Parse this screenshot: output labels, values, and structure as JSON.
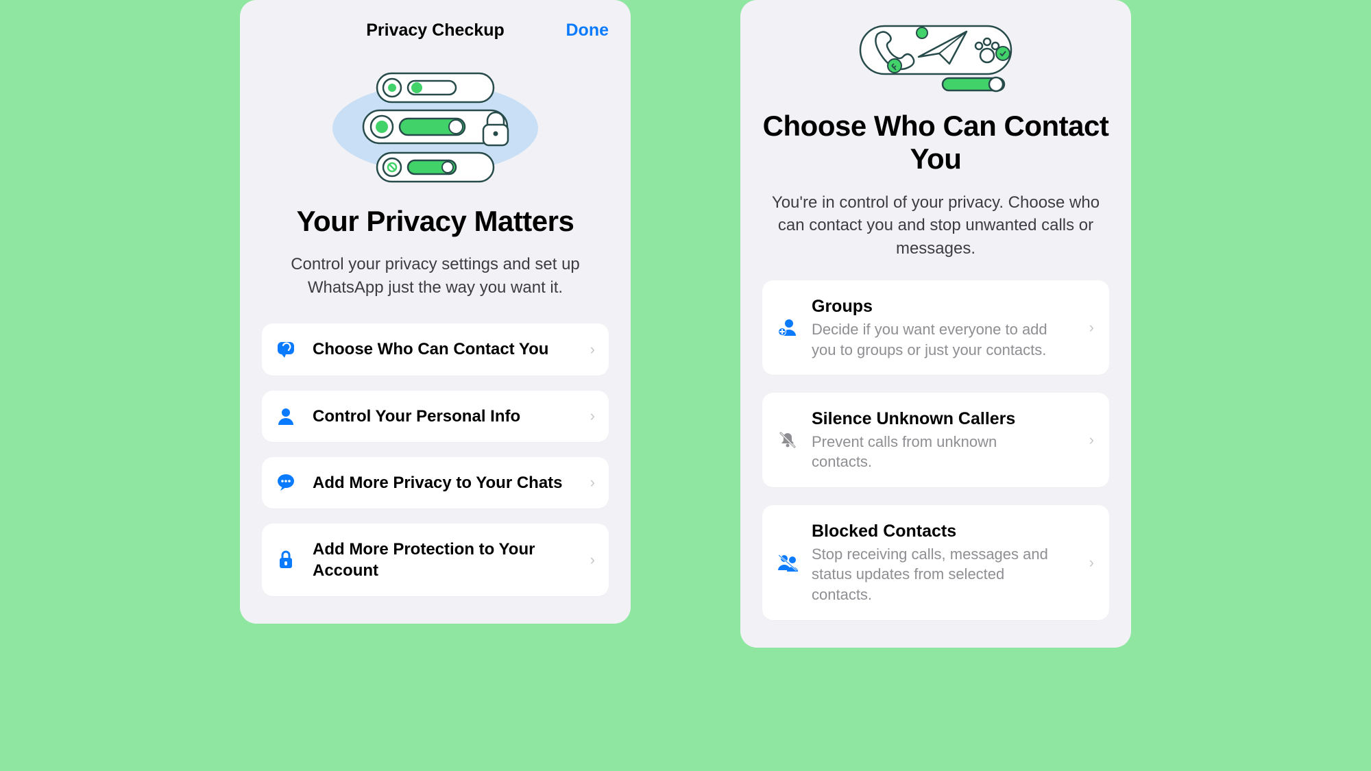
{
  "colors": {
    "accent_blue": "#0a7aff",
    "icon_blue": "#0a7aff",
    "icon_gray": "#8e8e93"
  },
  "screenA": {
    "header": {
      "title": "Privacy Checkup",
      "done": "Done"
    },
    "heading": "Your Privacy Matters",
    "sub": "Control your privacy settings and set up WhatsApp just the way you want it.",
    "items": [
      {
        "icon": "contact-bubble-icon",
        "title": "Choose Who Can Contact You"
      },
      {
        "icon": "person-icon",
        "title": "Control Your Personal Info"
      },
      {
        "icon": "chat-bubble-icon",
        "title": "Add More Privacy to Your Chats"
      },
      {
        "icon": "lock-shield-icon",
        "title": "Add More Protection to Your Account"
      }
    ]
  },
  "screenB": {
    "heading": "Choose Who Can Contact You",
    "sub": "You're in control of your privacy. Choose who can contact you and stop unwanted calls or messages.",
    "items": [
      {
        "icon": "group-add-icon",
        "title": "Groups",
        "desc": "Decide if you want everyone to add you to groups or just your contacts."
      },
      {
        "icon": "bell-slash-icon",
        "title": "Silence Unknown Callers",
        "desc": "Prevent calls from unknown contacts."
      },
      {
        "icon": "person-blocked-icon",
        "title": "Blocked Contacts",
        "desc": "Stop receiving calls, messages and status updates from selected contacts."
      }
    ]
  }
}
